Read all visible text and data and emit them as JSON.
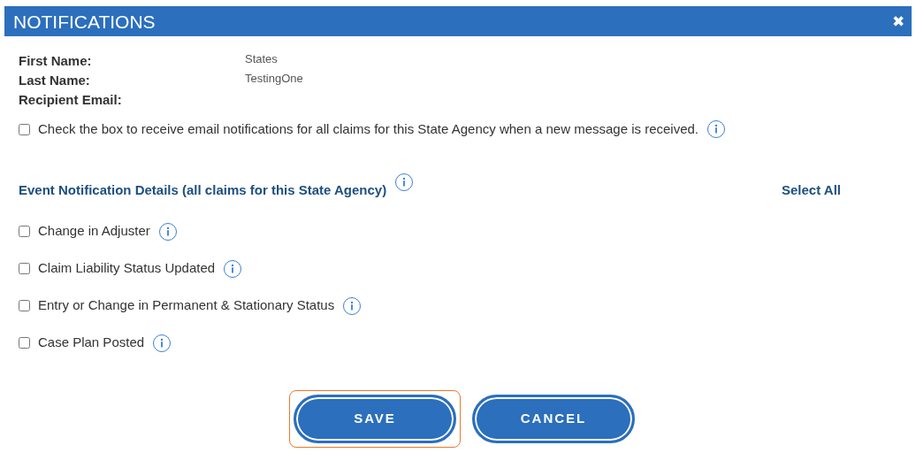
{
  "window": {
    "title": "NOTIFICATIONS",
    "close": "✖"
  },
  "fields": [
    {
      "label": "First Name:",
      "value": "States"
    },
    {
      "label": "Last Name:",
      "value": "TestingOne"
    },
    {
      "label": "Recipient Email:"
    }
  ],
  "email_option": {
    "label": "Check the box to receive email notifications for all claims for this State Agency when a new message is received.",
    "checked": false
  },
  "event_section": {
    "title": "Event Notification Details (all claims for this State Agency)",
    "select_all": "Select All",
    "items": [
      {
        "label": "Change in Adjuster",
        "checked": false
      },
      {
        "label": "Claim Liability Status Updated",
        "checked": false
      },
      {
        "label": "Entry or Change in Permanent & Stationary Status",
        "checked": false
      },
      {
        "label": "Case Plan Posted",
        "checked": false
      }
    ]
  },
  "buttons": [
    {
      "label": "SAVE",
      "focused": true
    },
    {
      "label": "CANCEL",
      "focused": false
    }
  ]
}
